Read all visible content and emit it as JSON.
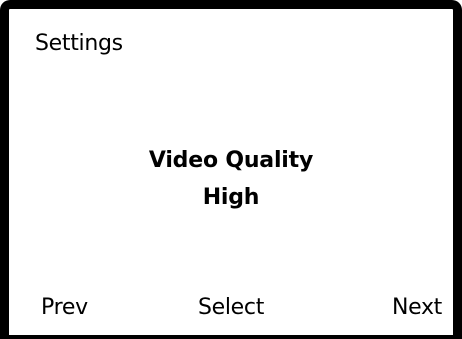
{
  "screen": {
    "title": "Settings"
  },
  "menu": {
    "label": "Video Quality",
    "value": "High"
  },
  "softkeys": {
    "prev": "Prev",
    "select": "Select",
    "next": "Next"
  },
  "colors": {
    "frame": "#000000",
    "background": "#ffffff",
    "text": "#000000"
  }
}
